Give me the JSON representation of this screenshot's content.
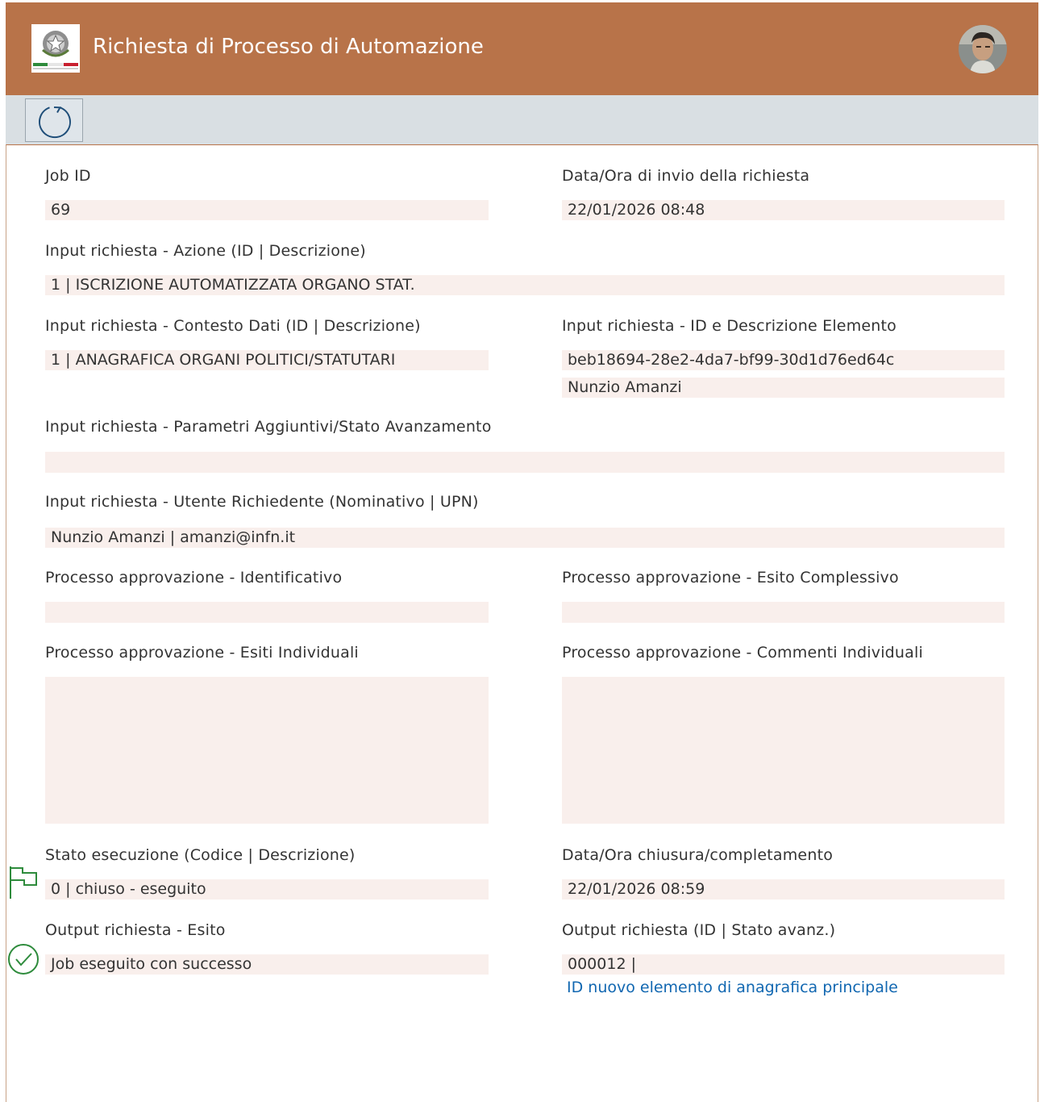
{
  "header": {
    "title": "Richiesta di Processo di Automazione",
    "background_color": "#b87349",
    "logo_icon": "italian-republic-emblem-icon",
    "avatar": "user-avatar"
  },
  "toolbar": {
    "refresh_icon": "refresh-icon"
  },
  "form": {
    "job_id": {
      "label": "Job ID",
      "value": "69"
    },
    "sent_at": {
      "label": "Data/Ora di invio della richiesta",
      "value": "22/01/2026 08:48"
    },
    "action": {
      "label": "Input richiesta - Azione (ID | Descrizione)",
      "value": "1 | ISCRIZIONE AUTOMATIZZATA ORGANO STAT."
    },
    "context": {
      "label": "Input richiesta - Contesto Dati (ID | Descrizione)",
      "value": "1 | ANAGRAFICA ORGANI POLITICI/STATUTARI"
    },
    "element": {
      "label": "Input richiesta - ID e Descrizione Elemento",
      "value_id": "beb18694-28e2-4da7-bf99-30d1d76ed64c",
      "value_desc": "Nunzio Amanzi"
    },
    "extra_params": {
      "label": "Input richiesta - Parametri Aggiuntivi/Stato Avanzamento",
      "value": ""
    },
    "requester": {
      "label": "Input richiesta - Utente Richiedente (Nominativo | UPN)",
      "value": "Nunzio Amanzi | amanzi@infn.it"
    },
    "approval_id": {
      "label": "Processo approvazione - Identificativo",
      "value": ""
    },
    "approval_outcome": {
      "label": "Processo approvazione - Esito Complessivo",
      "value": ""
    },
    "approval_individual": {
      "label": "Processo approvazione - Esiti Individuali",
      "value": ""
    },
    "approval_comments": {
      "label": "Processo approvazione - Commenti Individuali",
      "value": ""
    },
    "exec_status": {
      "label": "Stato esecuzione (Codice | Descrizione)",
      "value": "0 | chiuso - eseguito",
      "icon": "flag-icon"
    },
    "closed_at": {
      "label": "Data/Ora chiusura/completamento",
      "value": "22/01/2026 08:59"
    },
    "output_result": {
      "label": "Output richiesta - Esito",
      "value": "Job eseguito con successo",
      "icon": "check-circle-icon"
    },
    "output_id": {
      "label": "Output richiesta (ID | Stato avanz.)",
      "value": "000012 |",
      "link": "ID nuovo elemento di anagrafica principale"
    }
  }
}
